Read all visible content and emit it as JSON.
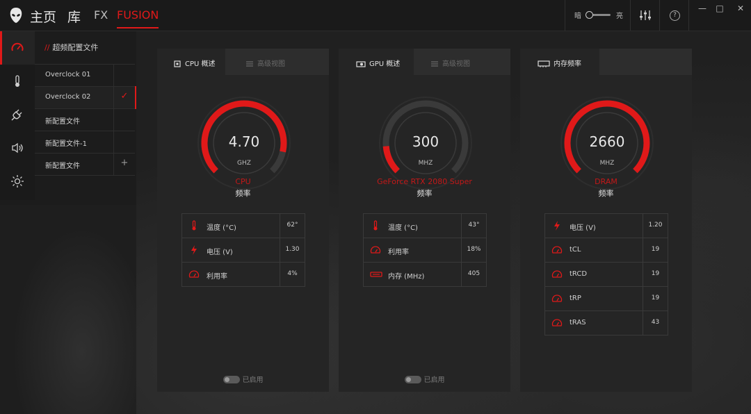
{
  "nav": {
    "home": "主页",
    "library": "库",
    "fx": "FX",
    "fusion": "FUSION"
  },
  "brightness": {
    "low": "暗",
    "high": "亮"
  },
  "help": "?",
  "window": {
    "minimize": "—",
    "maximize": "□",
    "close": "✕"
  },
  "rail": [
    "gauge-icon",
    "thermometer-icon",
    "power-plug-icon",
    "speaker-icon",
    "brightness-icon"
  ],
  "profiles": {
    "title_prefix": "//",
    "title": "超频配置文件",
    "items": [
      {
        "name": "Overclock 01",
        "mark": ""
      },
      {
        "name": "Overclock 02",
        "mark": "✓"
      },
      {
        "name": "新配置文件",
        "mark": ""
      },
      {
        "name": "新配置文件-1",
        "mark": ""
      },
      {
        "name": "新配置文件",
        "mark": "+"
      }
    ]
  },
  "cards": [
    {
      "tabs": [
        "CPU 概述",
        "高级视图"
      ],
      "gauge": {
        "value": "4.70",
        "unit": "GHZ",
        "fill": 0.88
      },
      "device": "CPU",
      "freq_label": "频率",
      "stats": [
        {
          "icon": "thermometer-icon",
          "label": "温度 (°C)",
          "value": "62°"
        },
        {
          "icon": "voltage-icon",
          "label": "电压 (V)",
          "value": "1.30"
        },
        {
          "icon": "usage-icon",
          "label": "利用率",
          "value": "4%"
        }
      ],
      "enabled_label": "已启用"
    },
    {
      "tabs": [
        "GPU 概述",
        "高级视图"
      ],
      "gauge": {
        "value": "300",
        "unit": "MHZ",
        "fill": 0.15
      },
      "device": "GeForce RTX 2080 Super",
      "freq_label": "频率",
      "stats": [
        {
          "icon": "thermometer-icon",
          "label": "温度 (°C)",
          "value": "43°"
        },
        {
          "icon": "usage-icon",
          "label": "利用率",
          "value": "18%"
        },
        {
          "icon": "memory-icon",
          "label": "内存 (MHz)",
          "value": "405"
        }
      ],
      "enabled_label": "已启用"
    },
    {
      "tabs": [
        "内存频率"
      ],
      "gauge": {
        "value": "2660",
        "unit": "MHZ",
        "fill": 1.0
      },
      "device": "DRAM",
      "freq_label": "频率",
      "stats": [
        {
          "icon": "voltage-icon",
          "label": "电压 (V)",
          "value": "1.20"
        },
        {
          "icon": "usage-icon",
          "label": "tCL",
          "value": "19"
        },
        {
          "icon": "usage-icon",
          "label": "tRCD",
          "value": "19"
        },
        {
          "icon": "usage-icon",
          "label": "tRP",
          "value": "19"
        },
        {
          "icon": "usage-icon",
          "label": "tRAS",
          "value": "43"
        }
      ]
    }
  ],
  "colors": {
    "accent": "#e01919",
    "device": "#c41818",
    "track": "#3a3a3a"
  }
}
